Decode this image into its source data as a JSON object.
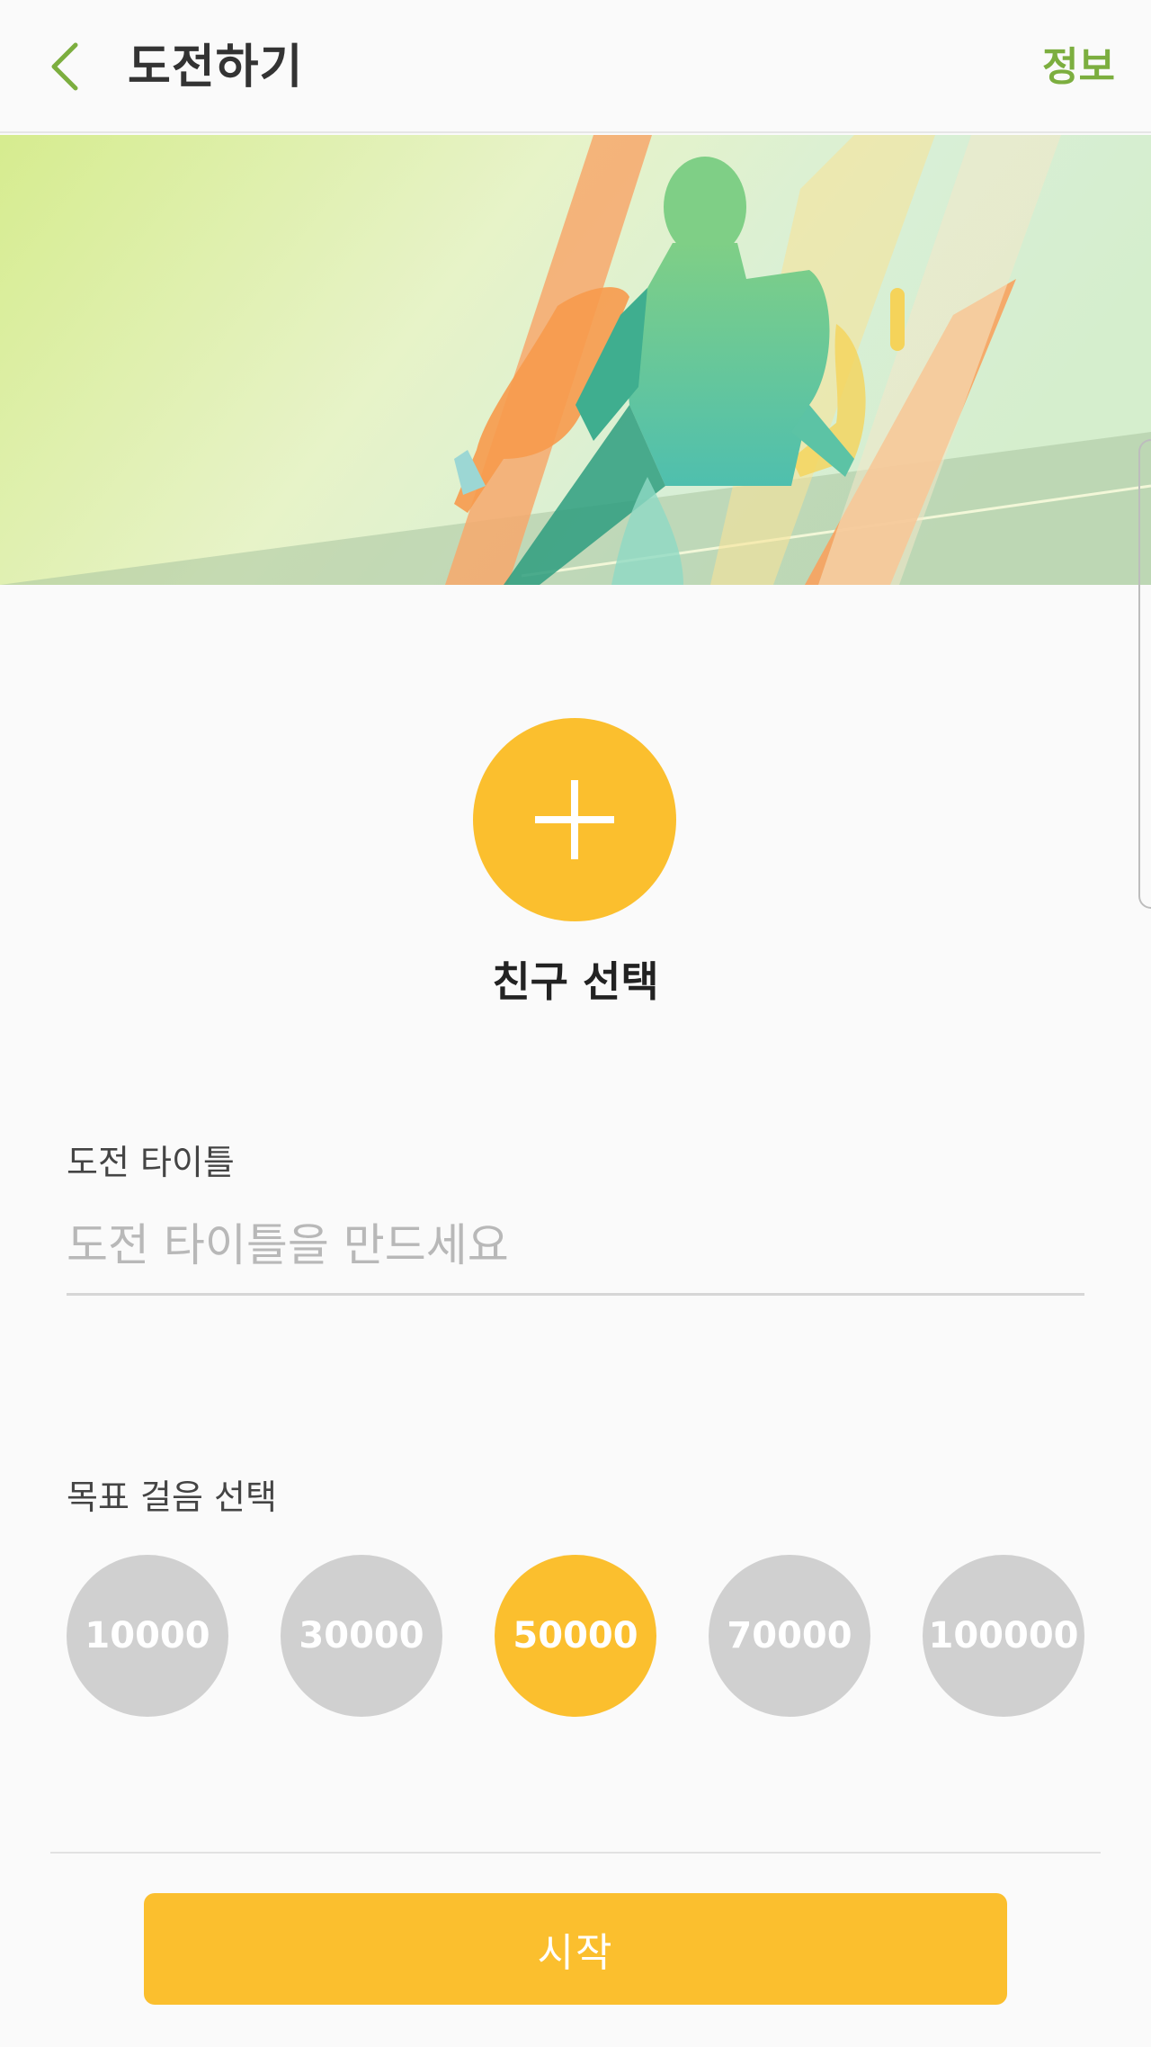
{
  "colors": {
    "accent_green": "#7cae3f",
    "accent_yellow": "#fbbf2e",
    "inactive_grey": "#d0d0d0"
  },
  "header": {
    "back_icon": "chevron-left-icon",
    "title": "도전하기",
    "info_label": "정보"
  },
  "banner": {
    "image": "runner-illustration"
  },
  "friend": {
    "add_icon": "plus-icon",
    "label": "친구 선택"
  },
  "challenge_title": {
    "label": "도전 타이틀",
    "value": "",
    "placeholder": "도전 타이틀을 만드세요"
  },
  "goal_steps": {
    "label": "목표 걸음 선택",
    "options": [
      "10000",
      "30000",
      "50000",
      "70000",
      "100000"
    ],
    "selected": "50000"
  },
  "start_button": {
    "label": "시작"
  }
}
